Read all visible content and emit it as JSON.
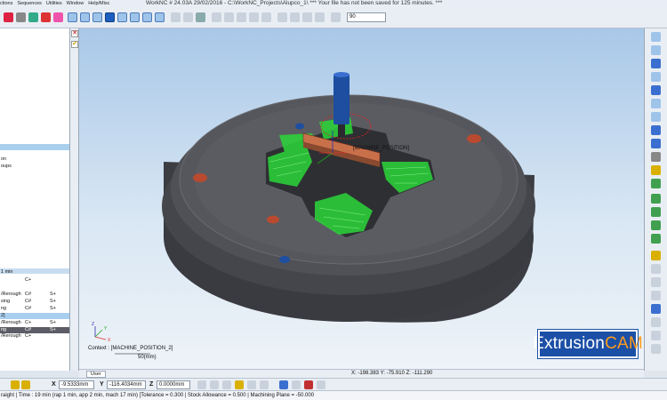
{
  "titlebar": {
    "menus": [
      "ctions",
      "Sequences",
      "Utilities",
      "Window",
      "Help/Misc"
    ],
    "title": "WorkNC # 24.03A     29/02/2016 - C:\\WorkNC_Projects\\Alupco_1\\ *** Your file has not been saved for 125 minutes. ***"
  },
  "toolbar": {
    "zoom_value": "90"
  },
  "left_panel": {
    "rows": [
      {
        "c1": "on"
      },
      {
        "c1": "oups"
      },
      {
        "c1": "1 min"
      },
      {
        "c1": "",
        "c2": "C+"
      },
      {
        "c1": "/Rerough",
        "c2": "C#",
        "c3": "S+"
      },
      {
        "c1": "sing",
        "c2": "C#",
        "c3": "S+"
      },
      {
        "c1": "ng",
        "c2": "C#",
        "c3": "S+"
      },
      {
        "c1": "2]"
      },
      {
        "c1": "/Rerough",
        "c2": "C+",
        "c3": "S+"
      },
      {
        "c1": "ng",
        "c2": "C#",
        "c3": "S+"
      },
      {
        "c1": "/Rerough",
        "c2": "C+"
      }
    ]
  },
  "viewport": {
    "machine_label": "[MACHINE_POSITION]",
    "context_label": "Context : [MACHINE_POSITION_2]",
    "scale_label": "50(mm)",
    "axis_x": "X",
    "axis_y": "Y",
    "axis_z": "Z"
  },
  "brand": {
    "part1": "Extrusion",
    "part2": "CAM"
  },
  "tabs": {
    "user": "User"
  },
  "coord_readout": "X: -198.383   Y: -75.910   Z: -111.290",
  "coordbar": {
    "x_label": "X",
    "x_value": "-9.5333mm",
    "y_label": "Y",
    "y_value": "-116.4034mm",
    "z_label": "Z",
    "z_value": "0.0000mm"
  },
  "statusbar": {
    "text": "raight | Time : 19 min (rap 1 min, app 2 min, mach 17 min) [Tolerance = 0.300 | Stock Allowance = 0.500 | Machining Plane = -50.000"
  },
  "colors": {
    "toolpath": "#2bd63a",
    "tool": "#1d4ea0",
    "fixture": "#c8704a",
    "body": "#4a4b50",
    "brand_bg": "#1c4fa6",
    "brand_accent": "#ff9c1a"
  }
}
